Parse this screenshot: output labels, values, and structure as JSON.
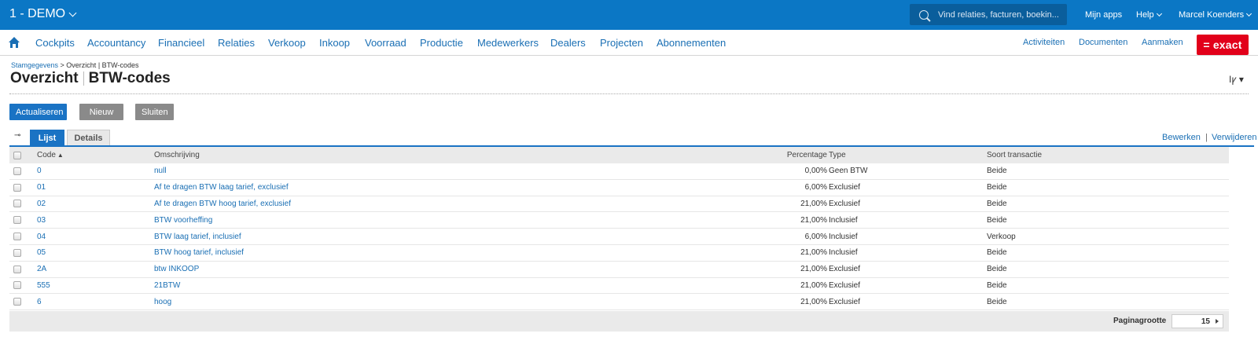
{
  "topbar": {
    "company": "1 - DEMO",
    "search_placeholder": "Vind relaties, facturen, boekin...",
    "links": [
      "Mijn apps",
      "Help",
      "Marcel Koenders"
    ]
  },
  "menu": {
    "items": [
      "Cockpits",
      "Accountancy",
      "Financieel",
      "Relaties",
      "Verkoop",
      "Inkoop",
      "Voorraad",
      "Productie",
      "Medewerkers",
      "Dealers",
      "Projecten",
      "Abonnementen"
    ],
    "right": [
      "Activiteiten",
      "Documenten",
      "Aanmaken"
    ],
    "logo": "= exact"
  },
  "header": {
    "breadcrumb_link": "Stamgegevens",
    "breadcrumb_rest": " > Overzicht | BTW-codes",
    "title_main": "Overzicht",
    "title_sub": "BTW-codes",
    "tools": "Iꝩ ▾"
  },
  "buttons": {
    "refresh": "Actualiseren",
    "new": "Nieuw",
    "close": "Sluiten"
  },
  "tabs": {
    "pin": "⊸",
    "list": "Lijst",
    "details": "Details"
  },
  "actions": {
    "edit": "Bewerken",
    "sep": "|",
    "delete": "Verwijderen"
  },
  "table": {
    "headers": {
      "code": "Code",
      "code_sort": "▲",
      "description": "Omschrijving",
      "percentage": "Percentage",
      "type": "Type",
      "transaction": "Soort transactie"
    },
    "rows": [
      {
        "code": "0",
        "description": "null",
        "percentage": "0,00%",
        "type": "Geen BTW",
        "transaction": "Beide"
      },
      {
        "code": "01",
        "description": "Af te dragen BTW laag tarief, exclusief",
        "percentage": "6,00%",
        "type": "Exclusief",
        "transaction": "Beide"
      },
      {
        "code": "02",
        "description": "Af te dragen BTW hoog tarief, exclusief",
        "percentage": "21,00%",
        "type": "Exclusief",
        "transaction": "Beide"
      },
      {
        "code": "03",
        "description": "BTW voorheffing",
        "percentage": "21,00%",
        "type": "Inclusief",
        "transaction": "Beide"
      },
      {
        "code": "04",
        "description": "BTW laag tarief, inclusief",
        "percentage": "6,00%",
        "type": "Inclusief",
        "transaction": "Verkoop"
      },
      {
        "code": "05",
        "description": "BTW hoog tarief, inclusief",
        "percentage": "21,00%",
        "type": "Inclusief",
        "transaction": "Beide"
      },
      {
        "code": "2A",
        "description": "btw INKOOP",
        "percentage": "21,00%",
        "type": "Exclusief",
        "transaction": "Beide"
      },
      {
        "code": "555",
        "description": "21BTW",
        "percentage": "21,00%",
        "type": "Exclusief",
        "transaction": "Beide"
      },
      {
        "code": "6",
        "description": "hoog",
        "percentage": "21,00%",
        "type": "Exclusief",
        "transaction": "Beide"
      }
    ]
  },
  "footer": {
    "page_size_label": "Paginagrootte",
    "page_size": "15"
  }
}
